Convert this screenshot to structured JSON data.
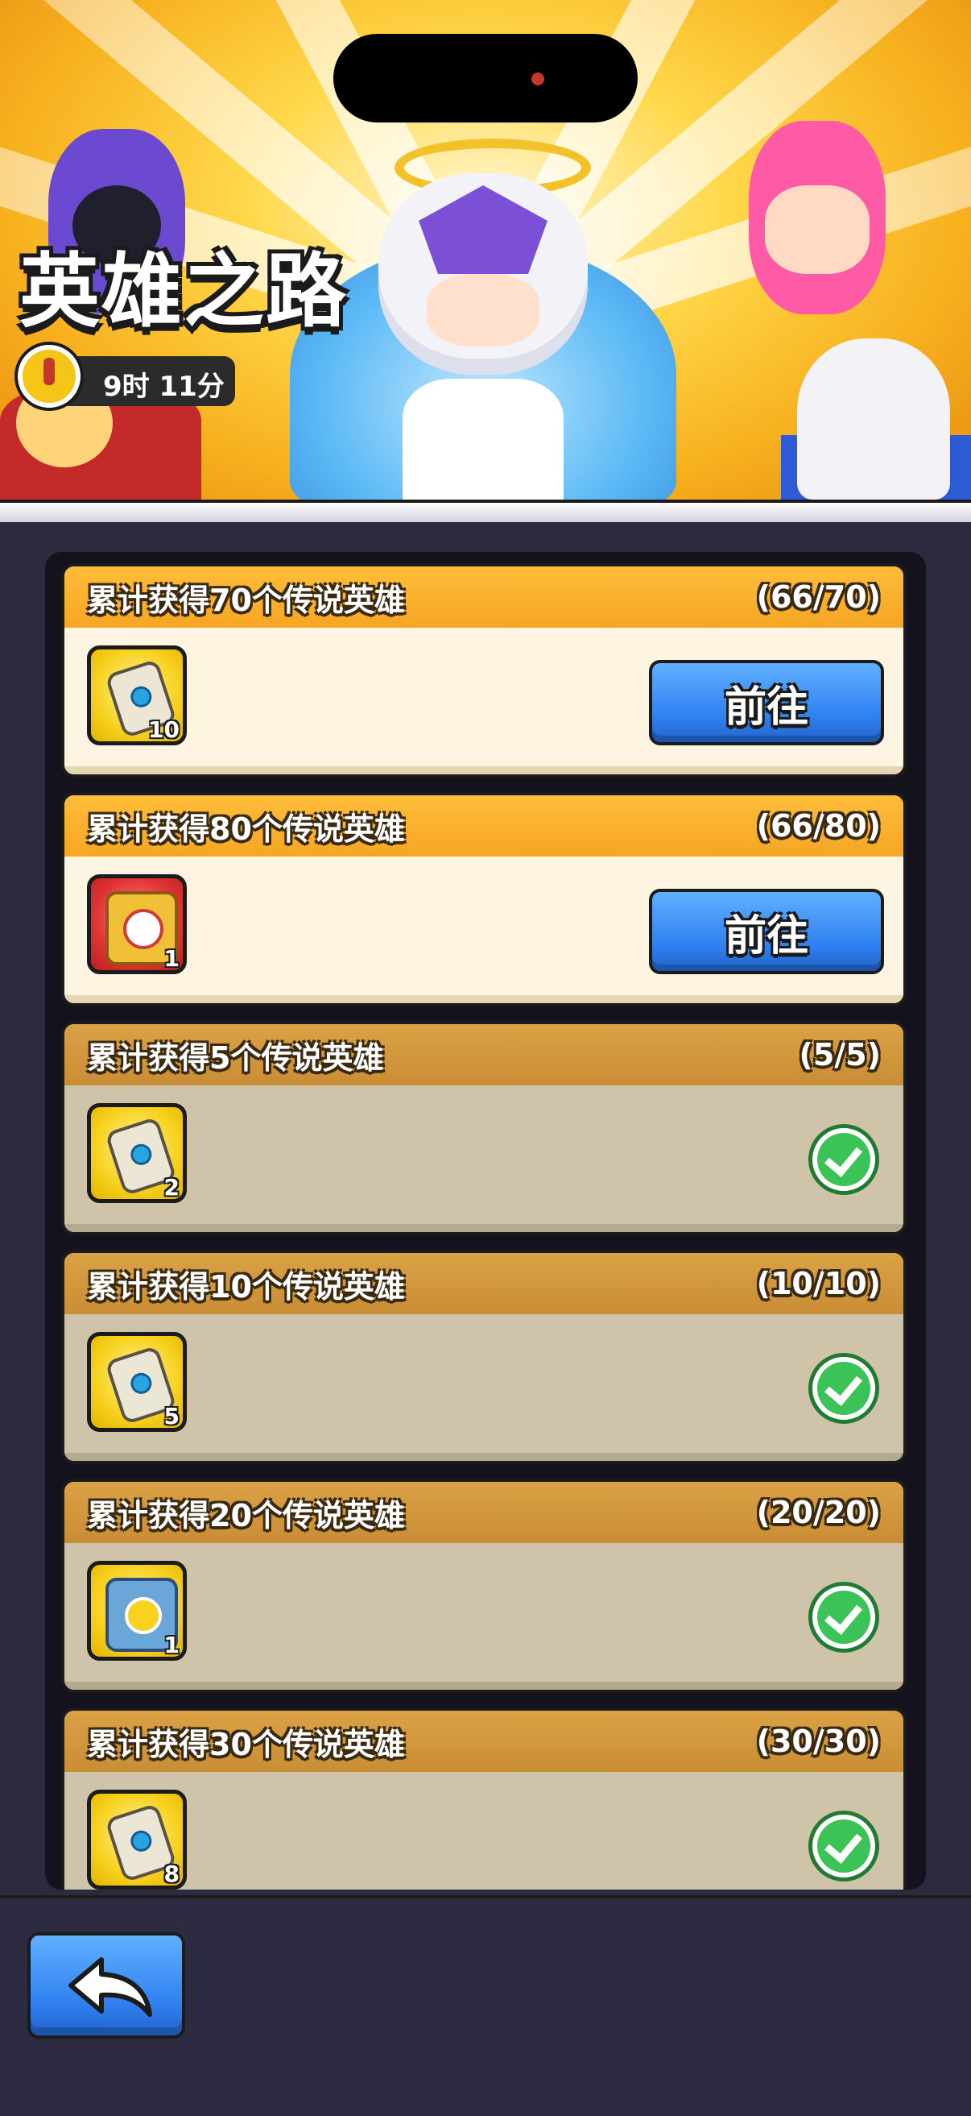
{
  "banner": {
    "title": "英雄之路",
    "timer": "9时 11分"
  },
  "rewards": [
    {
      "title": "累计获得70个传说英雄",
      "progress": "(66/70)",
      "item_icon": "scroll-icon",
      "qty": "10",
      "status": "active",
      "button_label": "前往"
    },
    {
      "title": "累计获得80个传说英雄",
      "progress": "(66/80)",
      "item_icon": "red-chest-icon",
      "qty": "1",
      "status": "active",
      "button_label": "前往"
    },
    {
      "title": "累计获得5个传说英雄",
      "progress": "(5/5)",
      "item_icon": "scroll-icon",
      "qty": "2",
      "status": "claimed"
    },
    {
      "title": "累计获得10个传说英雄",
      "progress": "(10/10)",
      "item_icon": "scroll-icon",
      "qty": "5",
      "status": "claimed"
    },
    {
      "title": "累计获得20个传说英雄",
      "progress": "(20/20)",
      "item_icon": "blue-chest-icon",
      "qty": "1",
      "status": "claimed"
    },
    {
      "title": "累计获得30个传说英雄",
      "progress": "(30/30)",
      "item_icon": "scroll-icon",
      "qty": "8",
      "status": "claimed"
    }
  ],
  "footer": {
    "back_icon": "back-arrow-icon"
  },
  "colors": {
    "active_header": "#f5a623",
    "done_header": "#c98e35",
    "button_blue": "#2f7ff0",
    "check_green": "#3cc357",
    "page_bg": "#2b2a3e"
  }
}
